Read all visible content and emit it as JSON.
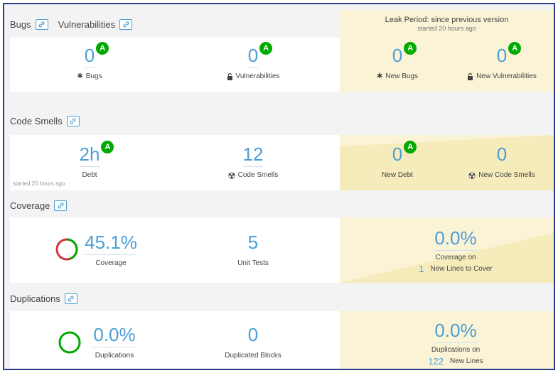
{
  "bugs_section": {
    "title_bugs": "Bugs",
    "title_vulns": "Vulnerabilities",
    "leak_title": "Leak Period: since previous version",
    "leak_sub": "started 20 hours ago",
    "bugs_value": "0",
    "bugs_rating": "A",
    "bugs_label": "Bugs",
    "vulns_value": "0",
    "vulns_rating": "A",
    "vulns_label": "Vulnerabilities",
    "new_bugs_value": "0",
    "new_bugs_rating": "A",
    "new_bugs_label": "New Bugs",
    "new_vulns_value": "0",
    "new_vulns_rating": "A",
    "new_vulns_label": "New Vulnerabilities"
  },
  "smells_section": {
    "title": "Code Smells",
    "debt_value": "2h",
    "debt_rating": "A",
    "debt_label": "Debt",
    "debt_note": "started 20 hours ago",
    "smells_value": "12",
    "smells_label": "Code Smells",
    "new_debt_value": "0",
    "new_debt_rating": "A",
    "new_debt_label": "New Debt",
    "new_smells_value": "0",
    "new_smells_label": "New Code Smells"
  },
  "coverage_section": {
    "title": "Coverage",
    "coverage_value": "45.1%",
    "coverage_fraction": 0.451,
    "coverage_label": "Coverage",
    "tests_value": "5",
    "tests_label": "Unit Tests",
    "new_coverage_value": "0.0%",
    "new_coverage_label": "Coverage on",
    "new_lines_value": "1",
    "new_lines_label": "New Lines to Cover"
  },
  "duplications_section": {
    "title": "Duplications",
    "dup_value": "0.0%",
    "dup_label": "Duplications",
    "blocks_value": "0",
    "blocks_label": "Duplicated Blocks",
    "new_dup_value": "0.0%",
    "new_dup_label": "Duplications on",
    "new_lines_value": "122",
    "new_lines_label": "New Lines"
  },
  "colors": {
    "accent": "#4b9fd5",
    "rating_a": "#00aa00",
    "leak_bg": "#fbf3d5",
    "coverage_good": "#00aa00",
    "coverage_bad": "#d4333f"
  }
}
